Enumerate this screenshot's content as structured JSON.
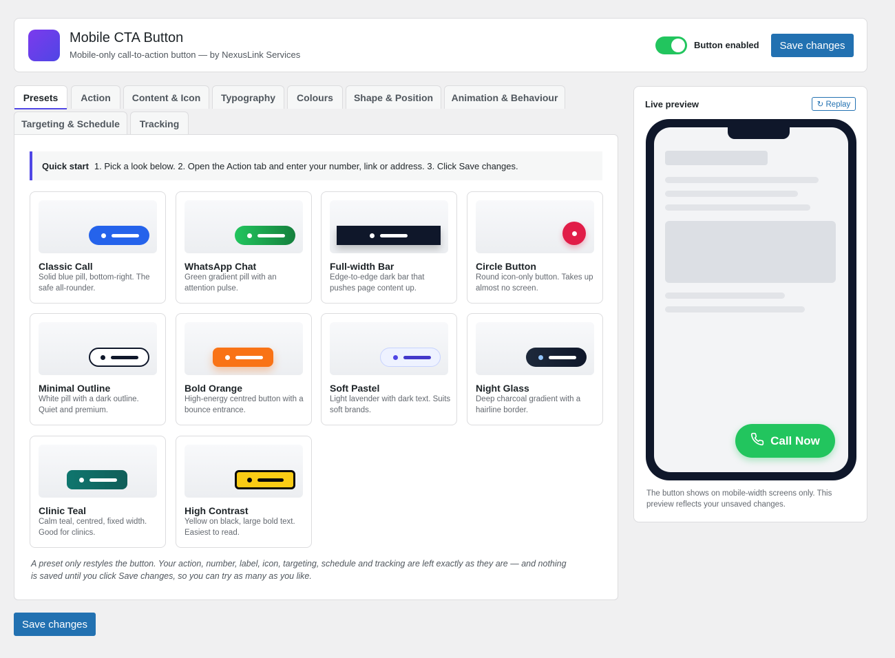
{
  "header": {
    "title": "Mobile CTA Button",
    "subtitle": "Mobile-only call-to-action button — by NexusLink Services",
    "toggle_label": "Button enabled",
    "toggle_on": true,
    "save_label": "Save changes"
  },
  "tabs": [
    {
      "label": "Presets",
      "active": true
    },
    {
      "label": "Action"
    },
    {
      "label": "Content & Icon"
    },
    {
      "label": "Typography"
    },
    {
      "label": "Colours"
    },
    {
      "label": "Shape & Position"
    },
    {
      "label": "Animation & Behaviour"
    },
    {
      "label": "Targeting & Schedule"
    },
    {
      "label": "Tracking"
    }
  ],
  "quickstart": {
    "heading": "Quick start",
    "text": "1. Pick a look below. 2. Open the Action tab and enter your number, link or address. 3. Click Save changes."
  },
  "presets": [
    {
      "name": "Classic Call",
      "desc": "Solid blue pill, bottom-right. The safe all-rounder.",
      "bg": "#2563eb"
    },
    {
      "name": "WhatsApp Chat",
      "desc": "Green gradient pill with an attention pulse.",
      "bg": "#16a34a"
    },
    {
      "name": "Full-width Bar",
      "desc": "Edge-to-edge dark bar that pushes page content up.",
      "bg": "#0f172a"
    },
    {
      "name": "Circle Button",
      "desc": "Round icon-only button. Takes up almost no screen.",
      "bg": "#e11d48"
    },
    {
      "name": "Minimal Outline",
      "desc": "White pill with a dark outline. Quiet and premium.",
      "bg": "#ffffff"
    },
    {
      "name": "Bold Orange",
      "desc": "High-energy centred button with a bounce entrance.",
      "bg": "#f97316"
    },
    {
      "name": "Soft Pastel",
      "desc": "Light lavender with dark text. Suits soft brands.",
      "bg": "#eef2ff"
    },
    {
      "name": "Night Glass",
      "desc": "Deep charcoal gradient with a hairline border.",
      "bg": "#1e293b"
    },
    {
      "name": "Clinic Teal",
      "desc": "Calm teal, centred, fixed width. Good for clinics.",
      "bg": "#0f766e"
    },
    {
      "name": "High Contrast",
      "desc": "Yellow on black, large bold text. Easiest to read.",
      "bg": "#facc15"
    }
  ],
  "note": "A preset only restyles the button. Your action, number, label, icon, targeting, schedule and tracking are left exactly as they are — and nothing is saved until you click Save changes, so you can try as many as you like.",
  "footer": {
    "save_label": "Save changes"
  },
  "preview": {
    "title": "Live preview",
    "replay_label": "↻ Replay",
    "cta_label": "Call Now",
    "cta_icon": "phone-icon",
    "cta_color": "#22c55e",
    "note": "The button shows on mobile-width screens only. This preview reflects your unsaved changes."
  }
}
